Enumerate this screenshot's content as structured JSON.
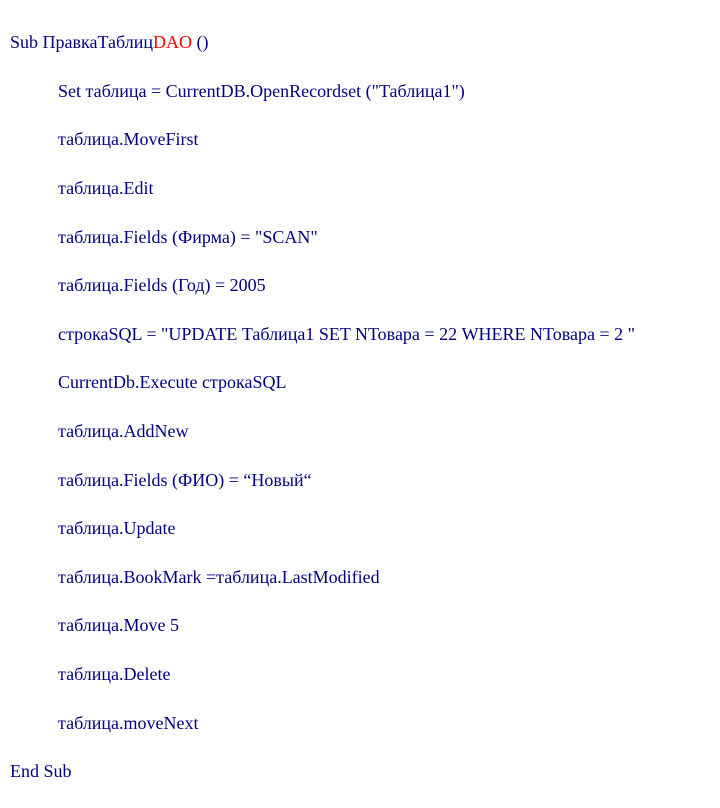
{
  "code": {
    "l0a": "Sub ПравкаТаблиц",
    "l0b": "DAO",
    "l0c": " ()",
    "l1": "Set таблица = CurrentDB.OpenRecordset (\"Таблица1\")",
    "l2": "таблица.MoveFirst",
    "l3": "таблица.Edit",
    "l4": "таблица.Fields (Фирма) = \"SCAN\"",
    "l5": "таблица.Fields (Год) = 2005",
    "l6": "строкаSQL = \"UPDATE Таблица1 SET NТовара = 22 WHERE NТовара = 2 \"",
    "l7": "CurrentDb.Execute строкаSQL",
    "l8": "таблица.AddNew",
    "l9": "таблица.Fields (ФИО) = “Новый“",
    "l10": "таблица.Update",
    "l11": "таблица.BookMark =таблица.LastModified",
    "l12": "таблица.Move 5",
    "l13": "таблица.Delete",
    "l14": "таблица.moveNext",
    "l15": "End Sub"
  }
}
